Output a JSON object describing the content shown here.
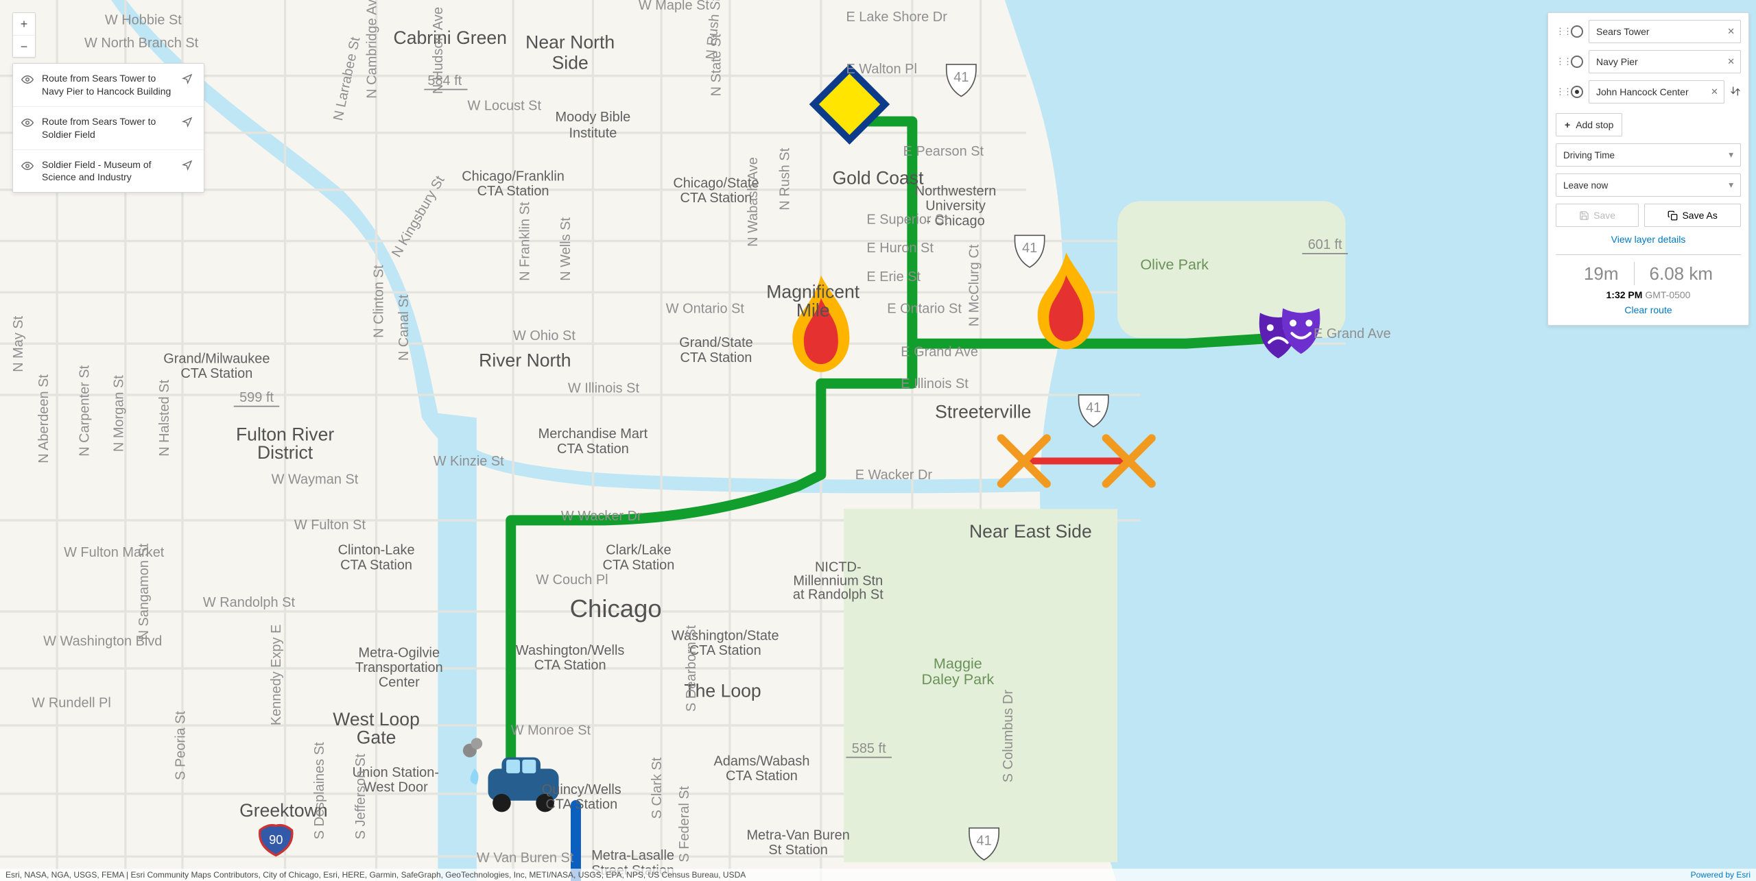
{
  "attribution": {
    "left": "Esri, NASA, NGA, USGS, FEMA | Esri Community Maps Contributors, City of Chicago, Esri, HERE, Garmin, SafeGraph, GeoTechnologies, Inc, METI/NASA, USGS, EPA, NPS, US Census Bureau, USDA",
    "right": "Powered by Esri"
  },
  "layers": [
    {
      "label": "Route from Sears Tower to Navy Pier to Hancock Building"
    },
    {
      "label": "Route from Sears Tower to Soldier Field"
    },
    {
      "label": "Soldier Field - Museum of Science and Industry"
    }
  ],
  "directions": {
    "stops": [
      {
        "value": "Sears Tower",
        "current": false
      },
      {
        "value": "Navy Pier",
        "current": false
      },
      {
        "value": "John Hancock Center",
        "current": true
      }
    ],
    "add_stop_label": "Add stop",
    "mode": {
      "selected": "Driving Time"
    },
    "depart": {
      "selected": "Leave now"
    },
    "save_label": "Save",
    "save_as_label": "Save As",
    "layer_details_label": "View layer details",
    "summary": {
      "duration": "19m",
      "distance": "6.08 km",
      "arrival_local": "1:32 PM",
      "tz": "GMT-0500",
      "clear_label": "Clear route"
    },
    "colors": {
      "accent": "#0079c1",
      "route_green": "#119e2d",
      "route_blue": "#0a5fbf"
    }
  },
  "map_labels": {
    "neighborhoods": {
      "near_north_side": "Near North\nSide",
      "gold_coast": "Gold Coast",
      "streeterville": "Streeterville",
      "river_north": "River North",
      "fulton_river": "Fulton River\nDistrict",
      "cabrini_green": "Cabrini Green",
      "greektown": "Greektown",
      "west_loop_gate": "West Loop\nGate",
      "the_loop": "The Loop",
      "near_east_side": "Near East Side",
      "chicago": "Chicago",
      "magnificent_mile": "Magnificent\nMile"
    },
    "parks": {
      "olive": "Olive Park",
      "maggie": "Maggie\nDaley Park"
    },
    "institutions": {
      "northwestern": "Northwestern\nUniversity\n- Chicago",
      "moody": "Moody Bible\nInstitute"
    },
    "streets": {
      "maple": "W Maple St",
      "hobbie": "W Hobbie St",
      "locust": "W Locust St",
      "walton": "E Walton Pl",
      "lakeshore": "E Lake Shore Dr",
      "pearson": "E Pearson St",
      "superior": "E Superior St",
      "huron": "E Huron St",
      "erie": "E Erie St",
      "ontario_w": "W Ontario St",
      "ontario_e": "E Ontario St",
      "ohio": "W Ohio St",
      "grand_e": "E Grand Ave",
      "illinois_w": "W Illinois St",
      "illinois_e": "E Illinois St",
      "kinzie": "W Kinzie St",
      "wacker_w": "W Wacker Dr",
      "wacker_e": "E Wacker Dr",
      "wayman": "W Wayman St",
      "couch": "W Couch Pl",
      "randolph": "W Randolph St",
      "washington": "W Washington Blvd",
      "monroe": "W Monroe St",
      "vanburen": "W Van Buren St",
      "rundell": "W Rundell Pl",
      "fulton_st": "W Fulton St",
      "fulton_mkt": "W Fulton Market",
      "n_branch": "W North Branch St",
      "may": "N May St",
      "aberdeen": "N Aberdeen St",
      "carpenter": "N Carpenter St",
      "morgan": "N Morgan St",
      "sangamon": "N Sangamon St",
      "peoria": "S Peoria St",
      "halsted": "N Halsted St",
      "desplaines": "S Desplaines St",
      "jefferson": "S Jefferson St",
      "canal": "N Canal St",
      "clinton": "N Clinton St",
      "kingsbury": "N Kingsbury St",
      "larrabee": "N Larrabee St",
      "cambridge": "N Cambridge Ave",
      "hudson": "N Hudson Ave",
      "franklin": "N Franklin St",
      "wells": "N Wells St",
      "clark": "S Clark St",
      "dearborn": "S Dearborn St",
      "state": "N State St",
      "wabash": "N Wabash Ave",
      "rush_n": "N Rush St",
      "rush_s": "N Rush St",
      "federal": "S Federal St",
      "mcclurg": "N McClurg Ct",
      "columbus": "S Columbus Dr",
      "kennedy": "Kennedy Expy E"
    },
    "cta": {
      "grand_milw": "Grand/Milwaukee\nCTA Station",
      "chi_franklin": "Chicago/Franklin\nCTA Station",
      "chi_state": "Chicago/State\nCTA Station",
      "grand_state": "Grand/State\nCTA Station",
      "merch_mart": "Merchandise Mart\nCTA Station",
      "clinton_lake": "Clinton-Lake\nCTA Station",
      "clark_lake": "Clark/Lake\nCTA Station",
      "wash_wells": "Washington/Wells\nCTA Station",
      "wash_state": "Washington/State\nCTA Station",
      "adams_wabash": "Adams/Wabash\nCTA Station",
      "quincy_wells": "Quincy/Wells\nCTA Station",
      "metra_ogilvie": "Metra-Ogilvie\nTransportation\nCenter",
      "union_stn": "Union Station-\nWest Door",
      "metra_vanburen": "Metra-Van Buren\nSt Station",
      "metra_lasalle": "Metra-Lasalle\nStreet Station",
      "nictd": "NICTD-\nMillennium Stn\nat Randolph St"
    },
    "scalebars": {
      "a": "584 ft",
      "b": "599 ft",
      "c": "601 ft",
      "d": "585 ft"
    },
    "shields": {
      "us41": "41",
      "i90": "90"
    }
  }
}
